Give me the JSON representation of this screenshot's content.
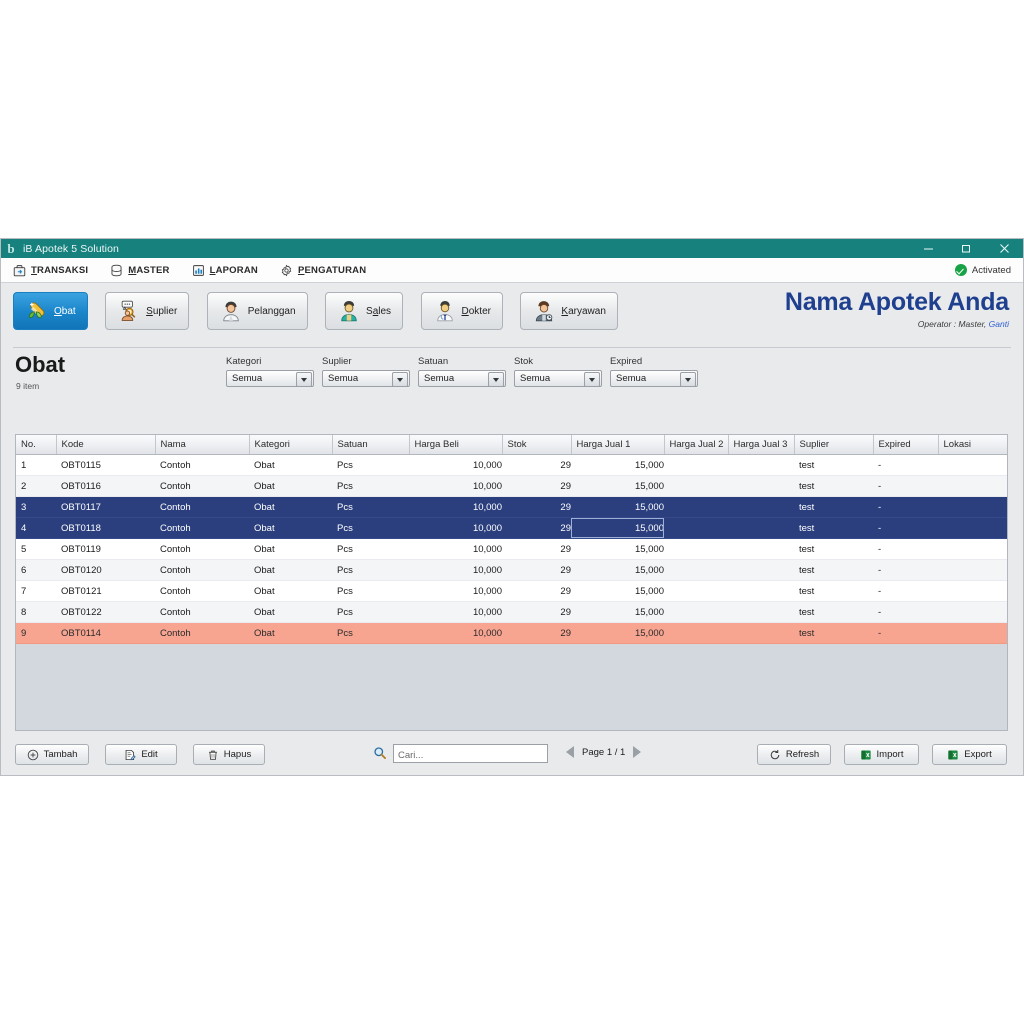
{
  "window": {
    "title": "iB Apotek 5 Solution",
    "app_icon": "b-logo-icon",
    "controls": {
      "minimize": "minimize-icon",
      "maximize": "restore-icon",
      "close": "close-icon"
    }
  },
  "menubar": {
    "items": [
      {
        "label": "TRANSAKSI",
        "accel": "T",
        "icon": "transaction-icon"
      },
      {
        "label": "MASTER",
        "accel": "M",
        "icon": "database-icon"
      },
      {
        "label": "LAPORAN",
        "accel": "L",
        "icon": "report-icon"
      },
      {
        "label": "PENGATURAN",
        "accel": "P",
        "icon": "gear-icon"
      }
    ],
    "status": {
      "label": "Activated",
      "icon": "green-check-icon",
      "color": "#19a347"
    }
  },
  "toolbar": {
    "buttons": [
      {
        "label": "Obat",
        "accel": "O",
        "icon": "pill-icon",
        "active": true
      },
      {
        "label": "Suplier",
        "accel": "S",
        "icon": "supplier-icon",
        "active": false
      },
      {
        "label": "Pelanggan",
        "accel": "g",
        "icon": "customer-icon",
        "active": false
      },
      {
        "label": "Sales",
        "accel": "a",
        "icon": "sales-icon",
        "active": false
      },
      {
        "label": "Dokter",
        "accel": "D",
        "icon": "doctor-icon",
        "active": false
      },
      {
        "label": "Karyawan",
        "accel": "K",
        "icon": "employee-icon",
        "active": false
      }
    ]
  },
  "brand": {
    "title": "Nama Apotek Anda",
    "operator_prefix": "Operator : Master, ",
    "operator_link": "Ganti",
    "title_color": "#1f3f8f"
  },
  "page": {
    "title": "Obat",
    "count": "9 item"
  },
  "filters": [
    {
      "label": "Kategori",
      "value": "Semua"
    },
    {
      "label": "Suplier",
      "value": "Semua"
    },
    {
      "label": "Satuan",
      "value": "Semua"
    },
    {
      "label": "Stok",
      "value": "Semua"
    },
    {
      "label": "Expired",
      "value": "Semua"
    }
  ],
  "grid": {
    "columns": [
      "No.",
      "Kode",
      "Nama",
      "Kategori",
      "Satuan",
      "Harga Beli",
      "Stok",
      "Harga Jual 1",
      "Harga Jual 2",
      "Harga Jual 3",
      "Suplier",
      "Expired",
      "Lokasi"
    ],
    "rows": [
      {
        "no": "1",
        "kode": "OBT0115",
        "nama": "Contoh",
        "kategori": "Obat",
        "satuan": "Pcs",
        "harga_beli": "10,000",
        "stok": "29",
        "jual1": "15,000",
        "jual2": "",
        "jual3": "",
        "suplier": "test",
        "expired": "-",
        "lokasi": "",
        "state": "odd"
      },
      {
        "no": "2",
        "kode": "OBT0116",
        "nama": "Contoh",
        "kategori": "Obat",
        "satuan": "Pcs",
        "harga_beli": "10,000",
        "stok": "29",
        "jual1": "15,000",
        "jual2": "",
        "jual3": "",
        "suplier": "test",
        "expired": "-",
        "lokasi": "",
        "state": "even"
      },
      {
        "no": "3",
        "kode": "OBT0117",
        "nama": "Contoh",
        "kategori": "Obat",
        "satuan": "Pcs",
        "harga_beli": "10,000",
        "stok": "29",
        "jual1": "15,000",
        "jual2": "",
        "jual3": "",
        "suplier": "test",
        "expired": "-",
        "lokasi": "",
        "state": "selected"
      },
      {
        "no": "4",
        "kode": "OBT0118",
        "nama": "Contoh",
        "kategori": "Obat",
        "satuan": "Pcs",
        "harga_beli": "10,000",
        "stok": "29",
        "jual1": "15,000",
        "jual2": "",
        "jual3": "",
        "suplier": "test",
        "expired": "-",
        "lokasi": "",
        "state": "selected",
        "focus_cell": "jual1"
      },
      {
        "no": "5",
        "kode": "OBT0119",
        "nama": "Contoh",
        "kategori": "Obat",
        "satuan": "Pcs",
        "harga_beli": "10,000",
        "stok": "29",
        "jual1": "15,000",
        "jual2": "",
        "jual3": "",
        "suplier": "test",
        "expired": "-",
        "lokasi": "",
        "state": "odd"
      },
      {
        "no": "6",
        "kode": "OBT0120",
        "nama": "Contoh",
        "kategori": "Obat",
        "satuan": "Pcs",
        "harga_beli": "10,000",
        "stok": "29",
        "jual1": "15,000",
        "jual2": "",
        "jual3": "",
        "suplier": "test",
        "expired": "-",
        "lokasi": "",
        "state": "even"
      },
      {
        "no": "7",
        "kode": "OBT0121",
        "nama": "Contoh",
        "kategori": "Obat",
        "satuan": "Pcs",
        "harga_beli": "10,000",
        "stok": "29",
        "jual1": "15,000",
        "jual2": "",
        "jual3": "",
        "suplier": "test",
        "expired": "-",
        "lokasi": "",
        "state": "odd"
      },
      {
        "no": "8",
        "kode": "OBT0122",
        "nama": "Contoh",
        "kategori": "Obat",
        "satuan": "Pcs",
        "harga_beli": "10,000",
        "stok": "29",
        "jual1": "15,000",
        "jual2": "",
        "jual3": "",
        "suplier": "test",
        "expired": "-",
        "lokasi": "",
        "state": "even"
      },
      {
        "no": "9",
        "kode": "OBT0114",
        "nama": "Contoh",
        "kategori": "Obat",
        "satuan": "Pcs",
        "harga_beli": "10,000",
        "stok": "29",
        "jual1": "15,000",
        "jual2": "",
        "jual3": "",
        "suplier": "test",
        "expired": "-",
        "lokasi": "",
        "state": "warning"
      }
    ],
    "selected_row_color": "#2b3f7e",
    "warning_row_color": "#f7a491"
  },
  "bottombar": {
    "add": {
      "label": "Tambah",
      "icon": "plus-circle-icon"
    },
    "edit": {
      "label": "Edit",
      "icon": "edit-document-icon"
    },
    "delete": {
      "label": "Hapus",
      "icon": "trash-icon"
    },
    "search": {
      "placeholder": "Cari...",
      "value": "",
      "icon": "search-icon"
    },
    "pager": {
      "label": "Page 1 / 1",
      "prev": "prev-page-arrow",
      "next": "next-page-arrow"
    },
    "refresh": {
      "label": "Refresh",
      "icon": "refresh-icon"
    },
    "import": {
      "label": "Import",
      "icon": "excel-icon"
    },
    "export": {
      "label": "Export",
      "icon": "excel-icon"
    }
  }
}
